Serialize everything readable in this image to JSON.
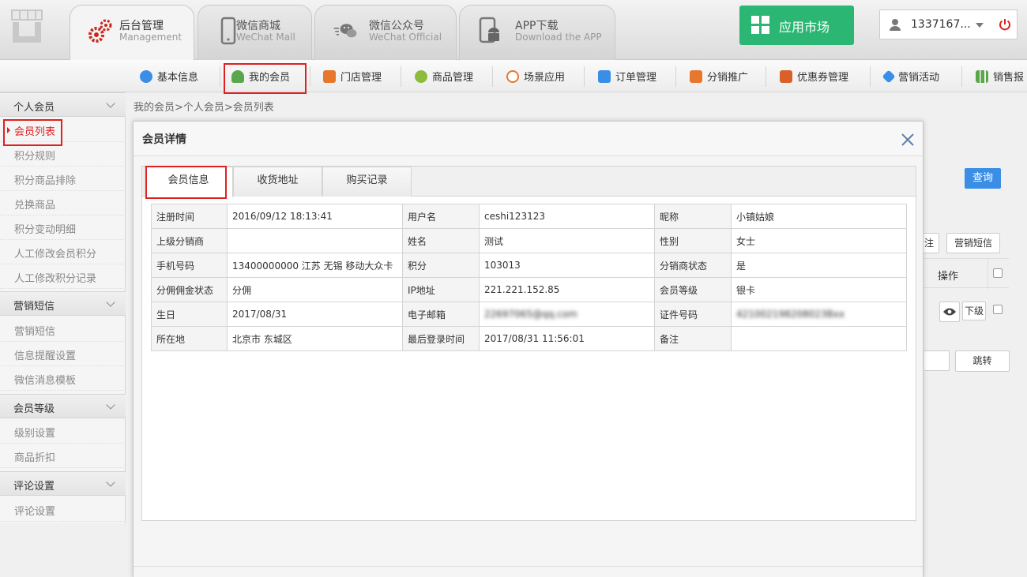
{
  "topbar": {
    "tabs": [
      {
        "title": "后台管理",
        "subtitle": "Management",
        "icon": "gears-icon"
      },
      {
        "title": "微信商城",
        "subtitle": "WeChat Mall",
        "icon": "phone-icon"
      },
      {
        "title": "微信公众号",
        "subtitle": "WeChat Official",
        "icon": "wechat-icon"
      },
      {
        "title": "APP下载",
        "subtitle": "Download the APP",
        "icon": "android-icon"
      }
    ],
    "app_market": "应用市场",
    "user_name": "1337167...",
    "accent_green": "#2bb673",
    "accent_red": "#e02020"
  },
  "secnav": {
    "items": [
      "基本信息",
      "我的会员",
      "门店管理",
      "商品管理",
      "场景应用",
      "订单管理",
      "分销推广",
      "优惠券管理",
      "营销活动",
      "销售报"
    ]
  },
  "sidebar": {
    "groups": [
      {
        "title": "个人会员",
        "items": [
          "会员列表",
          "积分规则",
          "积分商品排除",
          "兑换商品",
          "积分变动明细",
          "人工修改会员积分",
          "人工修改积分记录"
        ]
      },
      {
        "title": "营销短信",
        "items": [
          "营销短信",
          "信息提醒设置",
          "微信消息模板"
        ]
      },
      {
        "title": "会员等级",
        "items": [
          "级别设置",
          "商品折扣"
        ]
      },
      {
        "title": "评论设置",
        "items": [
          "评论设置"
        ]
      }
    ]
  },
  "breadcrumb": "我的会员>个人会员>会员列表",
  "background": {
    "query": "查询",
    "note_btn": "注",
    "sms_btn": "营销短信",
    "ops_header": "操作",
    "sub_btn": "下级",
    "jump_btn": "跳转"
  },
  "modal": {
    "title": "会员详情",
    "tabs": [
      "会员信息",
      "收货地址",
      "购买记录"
    ],
    "rows": [
      [
        [
          "注册时间",
          "2016/09/12 18:13:41"
        ],
        [
          "用户名",
          "ceshi123123"
        ],
        [
          "昵称",
          "小镇姑娘"
        ]
      ],
      [
        [
          "上级分销商",
          ""
        ],
        [
          "姓名",
          "测试"
        ],
        [
          "性别",
          "女士"
        ]
      ],
      [
        [
          "手机号码",
          "13400000000 江苏 无锡 移动大众卡"
        ],
        [
          "积分",
          "103013"
        ],
        [
          "分销商状态",
          "是"
        ]
      ],
      [
        [
          "分佣佣金状态",
          "分佣"
        ],
        [
          "IP地址",
          "221.221.152.85"
        ],
        [
          "会员等级",
          "银卡"
        ]
      ],
      [
        [
          "生日",
          "2017/08/31"
        ],
        [
          "电子邮箱",
          "22697065@qq.com"
        ],
        [
          "证件号码",
          "421002198208023Bxx"
        ]
      ],
      [
        [
          "所在地",
          "北京市 东城区"
        ],
        [
          "最后登录时间",
          "2017/08/31 11:56:01"
        ],
        [
          "备注",
          ""
        ]
      ]
    ]
  }
}
